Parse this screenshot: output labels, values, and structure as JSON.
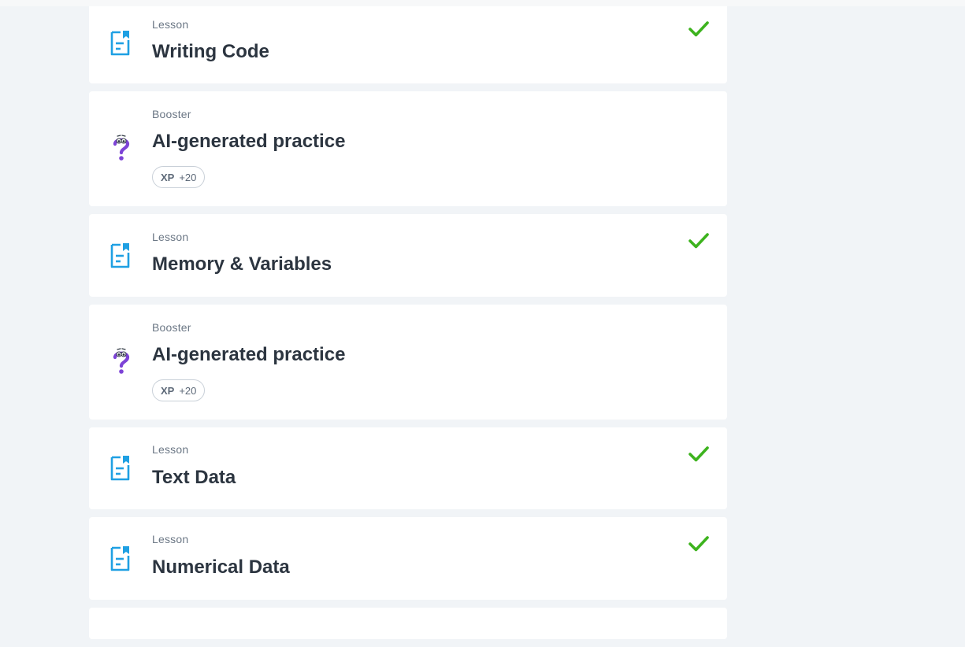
{
  "items": [
    {
      "type": "Lesson",
      "title": "Writing Code",
      "completed": true
    },
    {
      "type": "Booster",
      "title": "AI-generated practice",
      "xp_label": "XP",
      "xp_value": "+20"
    },
    {
      "type": "Lesson",
      "title": "Memory & Variables",
      "completed": true
    },
    {
      "type": "Booster",
      "title": "AI-generated practice",
      "xp_label": "XP",
      "xp_value": "+20"
    },
    {
      "type": "Lesson",
      "title": "Text Data",
      "completed": true
    },
    {
      "type": "Lesson",
      "title": "Numerical Data",
      "completed": true
    }
  ],
  "colors": {
    "lesson_icon": "#1fa0e3",
    "booster_icon": "#7d43d6",
    "check": "#3db31e",
    "background": "#f1f4f7",
    "card": "#ffffff",
    "title_text": "#2c3540",
    "label_text": "#6b7785"
  },
  "icons": {
    "lesson": "lesson-document-icon",
    "booster": "question-mark-face-icon",
    "completed": "checkmark-icon"
  }
}
